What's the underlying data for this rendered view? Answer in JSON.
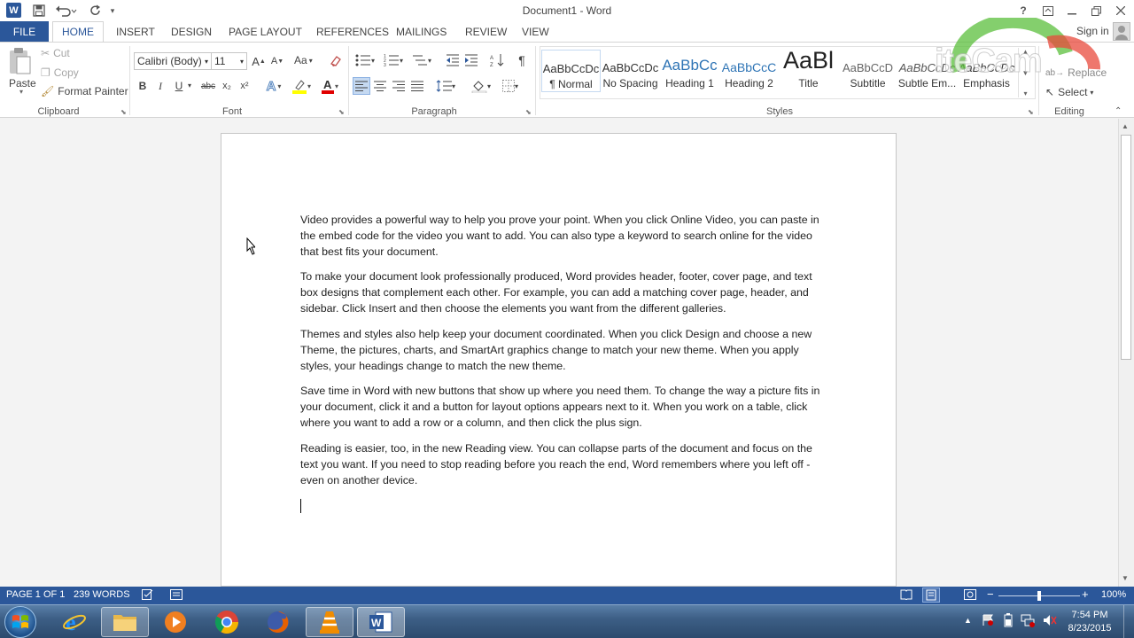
{
  "window": {
    "title": "Document1 - Word",
    "help": "?",
    "sign_in": "Sign in"
  },
  "tabs": [
    {
      "label": "FILE"
    },
    {
      "label": "HOME"
    },
    {
      "label": "INSERT"
    },
    {
      "label": "DESIGN"
    },
    {
      "label": "PAGE LAYOUT"
    },
    {
      "label": "REFERENCES"
    },
    {
      "label": "MAILINGS"
    },
    {
      "label": "REVIEW"
    },
    {
      "label": "VIEW"
    }
  ],
  "clipboard": {
    "paste": "Paste",
    "cut": "Cut",
    "copy": "Copy",
    "format_painter": "Format Painter",
    "label": "Clipboard"
  },
  "font": {
    "family": "Calibri (Body)",
    "size": "11",
    "change_case": "Aa",
    "label": "Font",
    "bold": "B",
    "italic": "I",
    "underline": "U",
    "strike": "abc",
    "sub": "x₂",
    "sup": "x²"
  },
  "paragraph": {
    "label": "Paragraph"
  },
  "styles": {
    "label": "Styles",
    "items": [
      {
        "sample": "AaBbCcDc",
        "name": "¶ Normal"
      },
      {
        "sample": "AaBbCcDc",
        "name": "No Spacing"
      },
      {
        "sample": "AaBbCc",
        "name": "Heading 1"
      },
      {
        "sample": "AaBbCcC",
        "name": "Heading 2"
      },
      {
        "sample": "AaBl",
        "name": "Title"
      },
      {
        "sample": "AaBbCcD",
        "name": "Subtitle"
      },
      {
        "sample": "AaBbCcDc",
        "name": "Subtle Em..."
      },
      {
        "sample": "AaBbCcDc",
        "name": "Emphasis"
      }
    ]
  },
  "editing": {
    "replace": "Replace",
    "select": "Select",
    "label": "Editing"
  },
  "watermark": "iteCam",
  "document": {
    "paragraphs": [
      "Video provides a powerful way to help you prove your point. When you click Online Video, you can paste in the embed code for the video you want to add. You can also type a keyword to search online for the video that best fits your document.",
      "To make your document look professionally produced, Word provides header, footer, cover page, and text box designs that complement each other. For example, you can add a matching cover page, header, and sidebar. Click Insert and then choose the elements you want from the different galleries.",
      "Themes and styles also help keep your document coordinated. When you click Design and choose a new Theme, the pictures, charts, and SmartArt graphics change to match your new theme. When you apply styles, your headings change to match the new theme.",
      "Save time in Word with new buttons that show up where you need them. To change the way a picture fits in your document, click it and a button for layout options appears next to it. When you work on a table, click where you want to add a row or a column, and then click the plus sign.",
      "Reading is easier, too, in the new Reading view. You can collapse parts of the document and focus on the text you want. If you need to stop reading before you reach the end, Word remembers where you left off - even on another device."
    ]
  },
  "status": {
    "page": "PAGE 1 OF 1",
    "words": "239 WORDS",
    "zoom": "100%",
    "zoom_level": 1.0
  },
  "taskbar": {
    "time": "7:54 PM",
    "date": "8/23/2015"
  },
  "colors": {
    "accent": "#2b579a",
    "taskbar": "#3d5f86"
  }
}
